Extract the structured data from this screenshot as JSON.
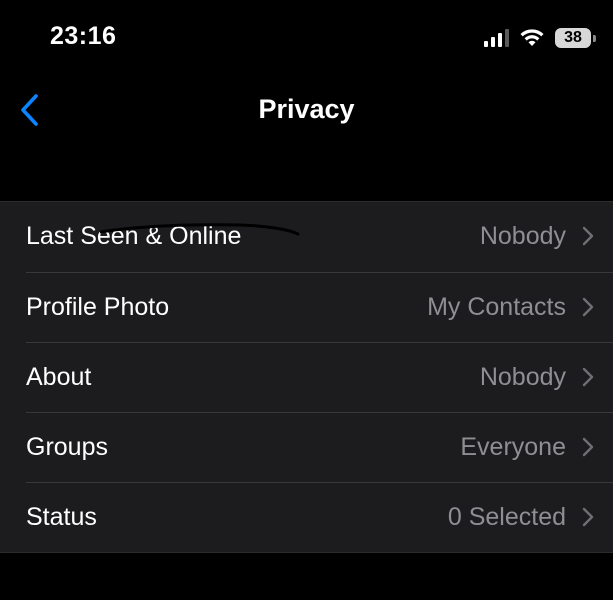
{
  "status_bar": {
    "time": "23:16",
    "battery": "38",
    "icons": [
      "signal-icon",
      "wifi-icon",
      "battery-icon"
    ]
  },
  "nav": {
    "title": "Privacy",
    "back_icon": "chevron-left-icon",
    "accent_color": "#0a84ff"
  },
  "privacy_items": [
    {
      "label": "Last Seen & Online",
      "value": "Nobody"
    },
    {
      "label": "Profile Photo",
      "value": "My Contacts"
    },
    {
      "label": "About",
      "value": "Nobody"
    },
    {
      "label": "Groups",
      "value": "Everyone"
    },
    {
      "label": "Status",
      "value": "0 Selected"
    }
  ]
}
